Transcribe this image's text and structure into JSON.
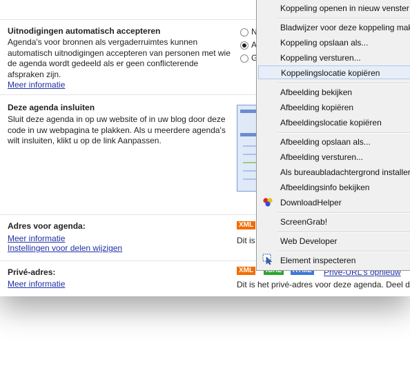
{
  "settings": {
    "auto_accept": {
      "title": "Uitnodigingen automatisch accepteren",
      "desc_lines": [
        "Agenda's voor bronnen als vergaderruimtes kunnen",
        "automatisch uitnodigingen accepteren van personen met wie",
        "de agenda wordt gedeeld als er geen conflicterende",
        "afspraken zijn."
      ],
      "more_info": "Meer informatie",
      "options": [
        {
          "label": "N",
          "selected": false
        },
        {
          "label": "A",
          "selected": true
        },
        {
          "label": "G",
          "selected": false
        }
      ]
    },
    "embed": {
      "title": "Deze agenda insluiten",
      "desc_lines": [
        "Sluit deze agenda in op uw website of in uw blog door deze",
        "code in uw webpagina te plakken. Als u meerdere agenda's",
        "wilt insluiten, klikt u op de link Aanpassen."
      ]
    },
    "address": {
      "title": "Adres voor agenda:",
      "more_info": "Meer informatie",
      "sharing_link": "Instellingen voor delen wijzigen",
      "badge_xml": "XML",
      "text": "Dit is"
    },
    "private": {
      "title": "Privé-adres:",
      "more_info": "Meer informatie",
      "badge_xml": "XML",
      "badge_ical": "ICAL",
      "badge_html": "HTML",
      "reset_link": "Privé-URL's opnieuw",
      "text": "Dit is het privé-adres voor deze agenda. Deel dit"
    }
  },
  "context_menu": {
    "items": [
      "Koppeling openen in nieuw venster",
      "Bladwijzer voor deze koppeling mak",
      "Koppeling opslaan als...",
      "Koppeling versturen...",
      "Koppelingslocatie kopiëren",
      "Afbeelding bekijken",
      "Afbeelding kopiëren",
      "Afbeeldingslocatie kopiëren",
      "Afbeelding opslaan als...",
      "Afbeelding versturen...",
      "Als bureaubladachtergrond installer",
      "Afbeeldingsinfo bekijken",
      "DownloadHelper",
      "ScreenGrab!",
      "Web Developer",
      "Element inspecteren"
    ],
    "highlighted": "Koppelingslocatie kopiëren"
  },
  "colors": {
    "link": "#1f2fa6",
    "menu_bg": "#f0f0f0",
    "highlight": "#e8eef8"
  },
  "icons": {
    "downloadhelper": "downloadhelper-icon",
    "inspect": "inspect-element-icon"
  }
}
